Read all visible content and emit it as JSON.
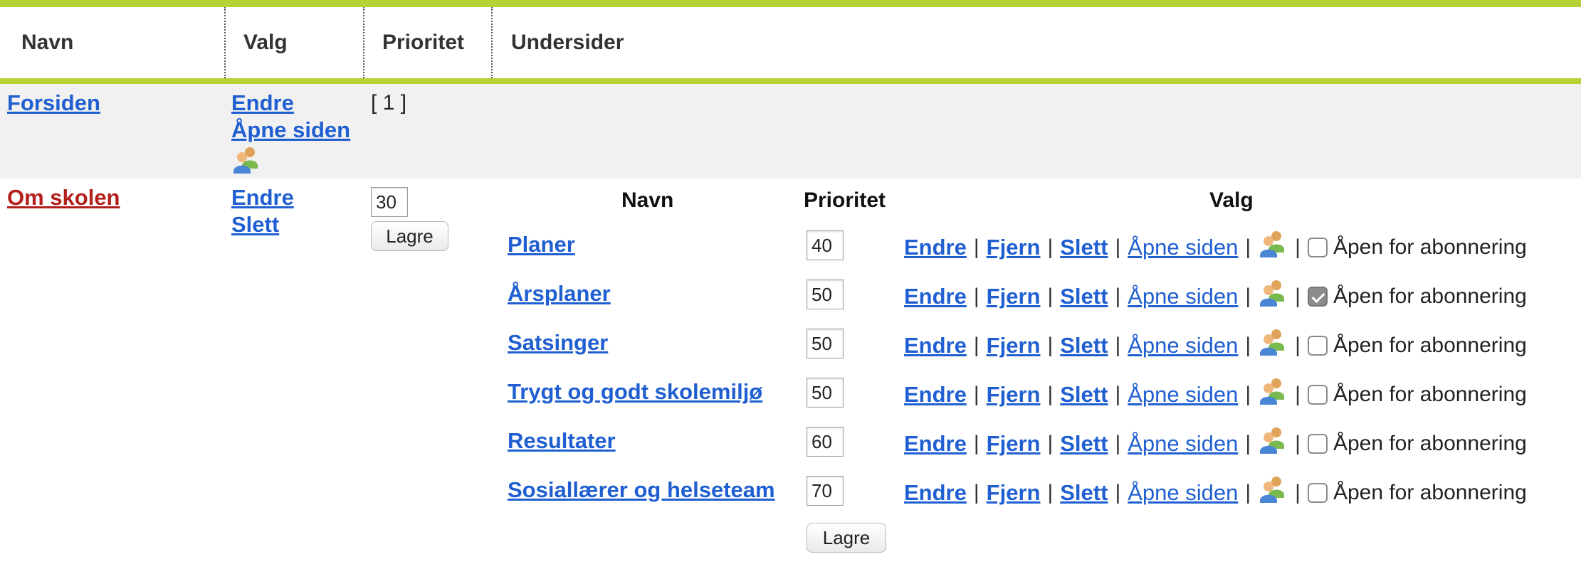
{
  "header": {
    "col_navn": "Navn",
    "col_valg": "Valg",
    "col_prioritet": "Prioritet",
    "col_undersider": "Undersider"
  },
  "rows": [
    {
      "name": "Forsiden",
      "actions": [
        "Endre",
        "Åpne siden"
      ],
      "priority_text": "[ 1 ]"
    },
    {
      "name": "Om skolen",
      "actions": [
        "Endre",
        "Slett"
      ],
      "priority_value": "30",
      "save_label": "Lagre"
    }
  ],
  "subpages": {
    "header": {
      "navn": "Navn",
      "prioritet": "Prioritet",
      "valg": "Valg"
    },
    "items": [
      {
        "name": "Planer",
        "priority": "40",
        "subscribed": false
      },
      {
        "name": "Årsplaner",
        "priority": "50",
        "subscribed": true
      },
      {
        "name": "Satsinger",
        "priority": "50",
        "subscribed": false
      },
      {
        "name": "Trygt og godt skolemiljø",
        "priority": "50",
        "subscribed": false
      },
      {
        "name": "Resultater",
        "priority": "60",
        "subscribed": false
      },
      {
        "name": "Sosiallærer og helseteam",
        "priority": "70",
        "subscribed": false
      }
    ],
    "action_labels": {
      "edit": "Endre",
      "remove": "Fjern",
      "delete": "Slett",
      "open": "Åpne siden",
      "separator": "|",
      "subscribe": "Åpen for abonnering"
    },
    "save_label": "Lagre"
  },
  "colors": {
    "accent_green": "#b5d337",
    "link_blue": "#1f5fd1",
    "active_red": "#b3201b",
    "row_bg": "#f1f1f1"
  },
  "icons": {
    "permissions": "user-group-icon"
  }
}
